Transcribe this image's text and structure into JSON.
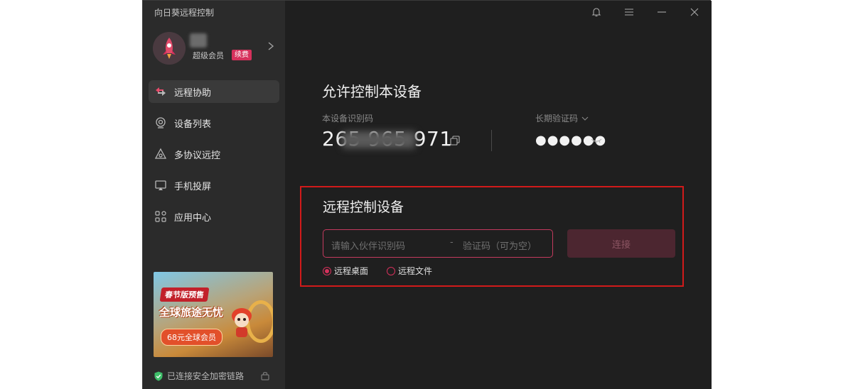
{
  "window": {
    "title": "向日葵远程控制"
  },
  "profile": {
    "member_text": "超级会员",
    "renew_label": "续费"
  },
  "sidebar": {
    "items": [
      {
        "label": "远程协助",
        "icon": "remote-assist-icon",
        "active": true
      },
      {
        "label": "设备列表",
        "icon": "device-list-icon",
        "active": false
      },
      {
        "label": "多协议远控",
        "icon": "multi-protocol-icon",
        "active": false
      },
      {
        "label": "手机投屏",
        "icon": "screen-cast-icon",
        "active": false
      },
      {
        "label": "应用中心",
        "icon": "app-center-icon",
        "active": false
      }
    ]
  },
  "promo": {
    "tag": "春节版预售",
    "title": "全球旅途无忧",
    "button": "68元全球会员"
  },
  "status": {
    "secure_text": "已连接安全加密链路"
  },
  "allow_control": {
    "title": "允许控制本设备",
    "device_id_label": "本设备识别码",
    "device_id_value": "265 965 971",
    "verify_label": "长期验证码",
    "verify_value": "●●●●●●"
  },
  "remote_control": {
    "title": "远程控制设备",
    "partner_placeholder": "请输入伙伴识别码",
    "separator": "-",
    "code_placeholder": "验证码（可为空）",
    "connect_label": "连接",
    "options": [
      {
        "label": "远程桌面",
        "checked": true
      },
      {
        "label": "远程文件",
        "checked": false
      }
    ]
  },
  "colors": {
    "accent": "#d6315c",
    "bg_main": "#1f1f1f",
    "bg_sidebar": "#2b2b2b",
    "highlight_border": "#d11a1a"
  }
}
